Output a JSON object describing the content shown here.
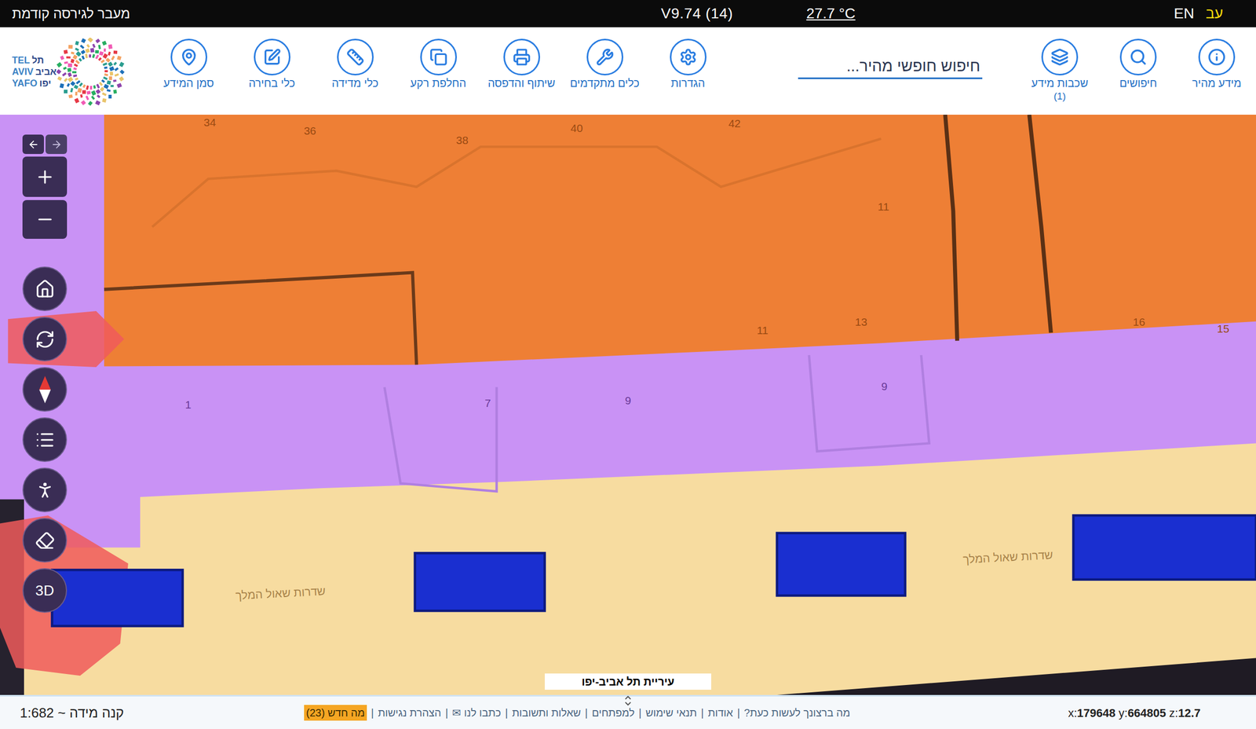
{
  "top_bar": {
    "previous_version": "מעבר לגירסה קודמת",
    "version": "V9.74 (14)",
    "temperature": "27.7 °C",
    "languages": [
      {
        "label": "EN",
        "selected": false
      },
      {
        "label": "עב",
        "selected": true
      }
    ]
  },
  "toolbar": {
    "primary": [
      {
        "label": "מידע מהיר",
        "badge": ""
      },
      {
        "label": "חיפושים",
        "badge": ""
      },
      {
        "label": "שכבות מידע",
        "badge": "(1)"
      }
    ],
    "search": {
      "placeholder": "חיפוש חופשי מהיר..."
    },
    "secondary": [
      {
        "label": "הגדרות"
      },
      {
        "label": "כלים מתקדמים"
      },
      {
        "label": "שיתוף והדפסה"
      },
      {
        "label": "החלפת רקע"
      },
      {
        "label": "כלי מדידה"
      },
      {
        "label": "כלי בחירה"
      },
      {
        "label": "סמן המידע"
      }
    ],
    "logo": [
      {
        "en": "TEL",
        "he": "תל"
      },
      {
        "en": "AVIV",
        "he": "אביב"
      },
      {
        "en": "YAFO",
        "he": "יפו"
      }
    ]
  },
  "map_controls": {
    "three_d": "3D"
  },
  "map": {
    "house_numbers": [
      "34",
      "36",
      "38",
      "40",
      "42",
      "11",
      "11",
      "13",
      "16",
      "15",
      "1",
      "7",
      "9",
      "9"
    ],
    "street_labels": [
      "שדרות שאול המלך",
      "שדרות שאול המלך"
    ],
    "credit": "עיריית תל אביב-יפו"
  },
  "status_bar": {
    "scale": "קנה מידה ~ 1:682",
    "separator": "|",
    "links": [
      {
        "label": "מה ברצונך לעשות כעת?",
        "kind": "link"
      },
      {
        "label": "אודות",
        "kind": "link"
      },
      {
        "label": "תנאי שימוש",
        "kind": "link"
      },
      {
        "label": "למפתחים",
        "kind": "link"
      },
      {
        "label": "שאלות ותשובות",
        "kind": "link"
      },
      {
        "label": "כתבו לנו ✉",
        "kind": "link"
      },
      {
        "label": "הצהרת נגישות",
        "kind": "link"
      },
      {
        "label": "מה חדש (23)",
        "kind": "badge"
      }
    ],
    "coordinates": [
      {
        "label": "x:",
        "value": "179648"
      },
      {
        "label": "y:",
        "value": "664805"
      },
      {
        "label": "z:",
        "value": "12.7"
      }
    ]
  }
}
